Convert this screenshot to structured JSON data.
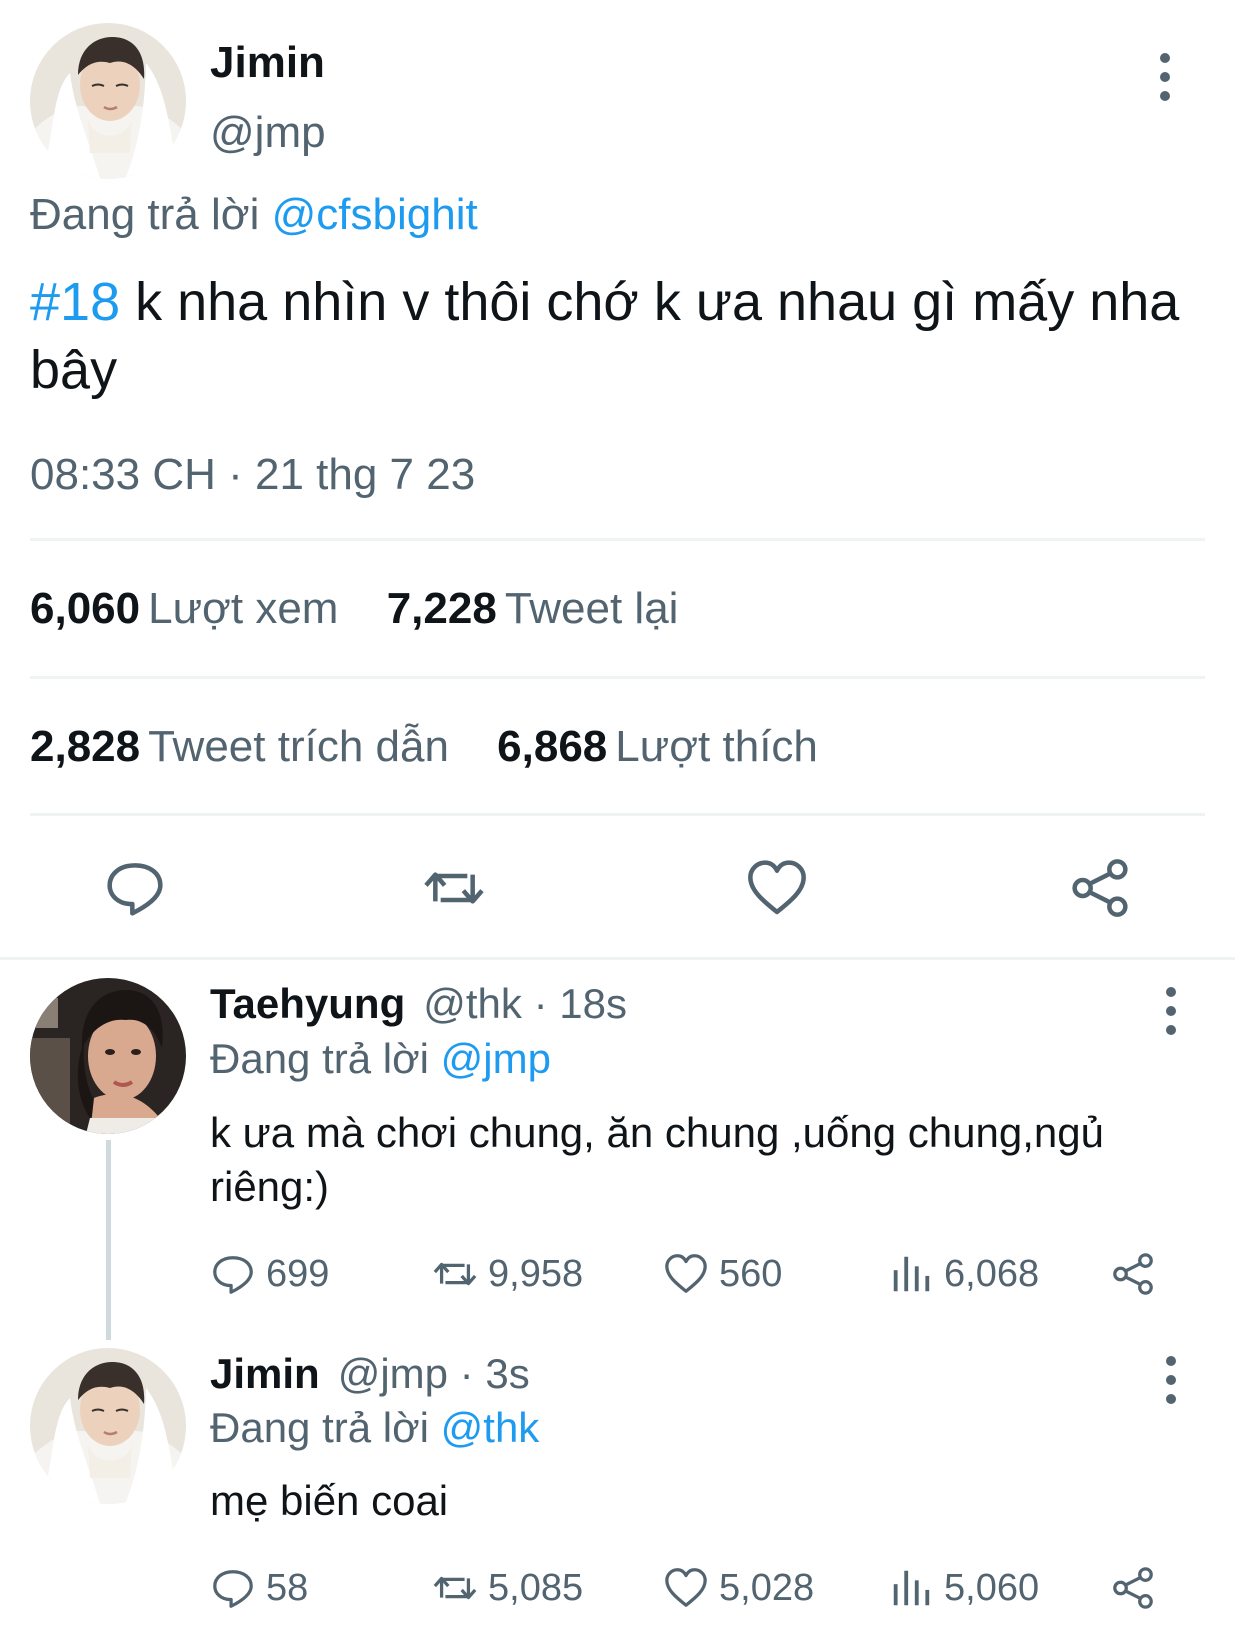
{
  "main_tweet": {
    "author_name": "Jimin",
    "author_handle": "@jmp",
    "replying_prefix": "Đang trả lời",
    "replying_to": "@cfsbighit",
    "hashtag": "#18",
    "text": " k nha nhìn v thôi chớ k ưa nhau gì mấy nha bây",
    "timestamp": "08:33 CH · 21 thg 7 23",
    "stats": {
      "views": "6,060",
      "views_label": "Lượt xem",
      "retweets": "7,228",
      "retweets_label": "Tweet lại",
      "quotes": "2,828",
      "quotes_label": "Tweet trích dẫn",
      "likes": "6,868",
      "likes_label": "Lượt thích"
    }
  },
  "replies": [
    {
      "author_name": "Taehyung",
      "meta": "@thk · 18s",
      "replying_prefix": "Đang trả lời",
      "replying_to": "@jmp",
      "text": "k ưa mà chơi chung, ăn chung ,uống chung,ngủ riêng:)",
      "replies": "699",
      "retweets": "9,958",
      "likes": "560",
      "views": "6,068"
    },
    {
      "author_name": "Jimin",
      "meta": "@jmp · 3s",
      "replying_prefix": "Đang trả lời",
      "replying_to": "@thk",
      "text": "mẹ biến coai",
      "replies": "58",
      "retweets": "5,085",
      "likes": "5,028",
      "views": "5,060"
    }
  ],
  "icons": {
    "reply": "speech-bubble-icon",
    "retweet": "retweet-icon",
    "like": "heart-icon",
    "share": "share-icon",
    "views": "bar-chart-icon",
    "more": "vertical-dots-icon"
  },
  "colors": {
    "link": "#1d9bf0",
    "muted": "#536471",
    "text": "#0f1419"
  }
}
